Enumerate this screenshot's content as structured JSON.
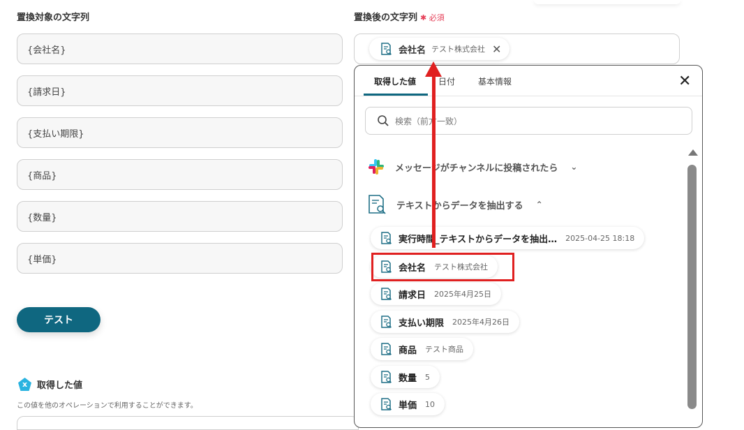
{
  "left": {
    "label": "置換対象の文字列",
    "fields": [
      "{会社名}",
      "{請求日}",
      "{支払い期限}",
      "{商品}",
      "{数量}",
      "{単価}"
    ],
    "test_button": "テスト",
    "got_title": "取得した値",
    "got_icon": "x",
    "got_desc": "この値を他のオペレーションで利用することができます。"
  },
  "right": {
    "label": "置換後の文字列",
    "required": "✱ 必須",
    "chip": {
      "label": "会社名",
      "value": "テスト株式会社"
    }
  },
  "panel": {
    "tabs": [
      "取得した値",
      "日付",
      "基本情報"
    ],
    "active_tab": 0,
    "search_placeholder": "検索（前方一致）",
    "groups": [
      {
        "label": "メッセージがチャンネルに投稿されたら",
        "expanded": false,
        "icon": "slack-icon"
      },
      {
        "label": "テキストからデータを抽出する",
        "expanded": true,
        "icon": "document-search-icon"
      }
    ],
    "items": [
      {
        "label": "実行時間_テキストからデータを抽出…",
        "value": "2025-04-25 18:18"
      },
      {
        "label": "会社名",
        "value": "テスト株式会社"
      },
      {
        "label": "請求日",
        "value": "2025年4月25日"
      },
      {
        "label": "支払い期限",
        "value": "2025年4月26日"
      },
      {
        "label": "商品",
        "value": "テスト商品"
      },
      {
        "label": "数量",
        "value": "5"
      },
      {
        "label": "単価",
        "value": "10"
      }
    ]
  },
  "colors": {
    "accent": "#0f6780",
    "annotation": "#e02020",
    "required": "#e53e57"
  }
}
